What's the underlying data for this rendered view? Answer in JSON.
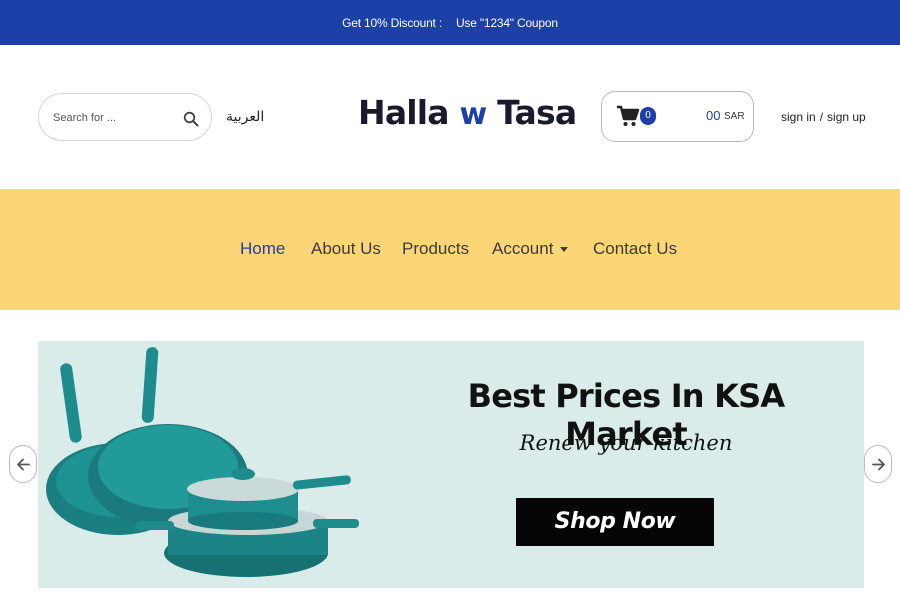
{
  "promo": {
    "label": "Get 10% Discount :",
    "text": "Use \"1234\" Coupon"
  },
  "header": {
    "search": {
      "placeholder": "Search for ...",
      "icon": "search-icon"
    },
    "language": "العربية",
    "logo": {
      "part1": "Halla ",
      "part2": "w",
      "part3": " Tasa"
    },
    "cart": {
      "icon": "shopping-cart-icon",
      "count": "0",
      "amount": "00",
      "currency": "SAR"
    },
    "auth": {
      "sign_in": "sign in",
      "separator": "/",
      "sign_up": "sign up"
    }
  },
  "nav": {
    "items": [
      {
        "label": "Home",
        "active": true
      },
      {
        "label": "About Us"
      },
      {
        "label": "Products"
      },
      {
        "label": "Account",
        "has_dropdown": true
      },
      {
        "label": "Contact Us"
      }
    ]
  },
  "slider": {
    "headline": "Best Prices In KSA Market",
    "subline": "Renew your kitchen",
    "button": "Shop Now",
    "prev_icon": "arrow-left-icon",
    "next_icon": "arrow-right-icon"
  },
  "colors": {
    "brand_blue": "#1c3fa8",
    "nav_yellow": "#fcd577",
    "banner_bg": "#d9ecea",
    "pan_teal": "#1e8c8c"
  }
}
